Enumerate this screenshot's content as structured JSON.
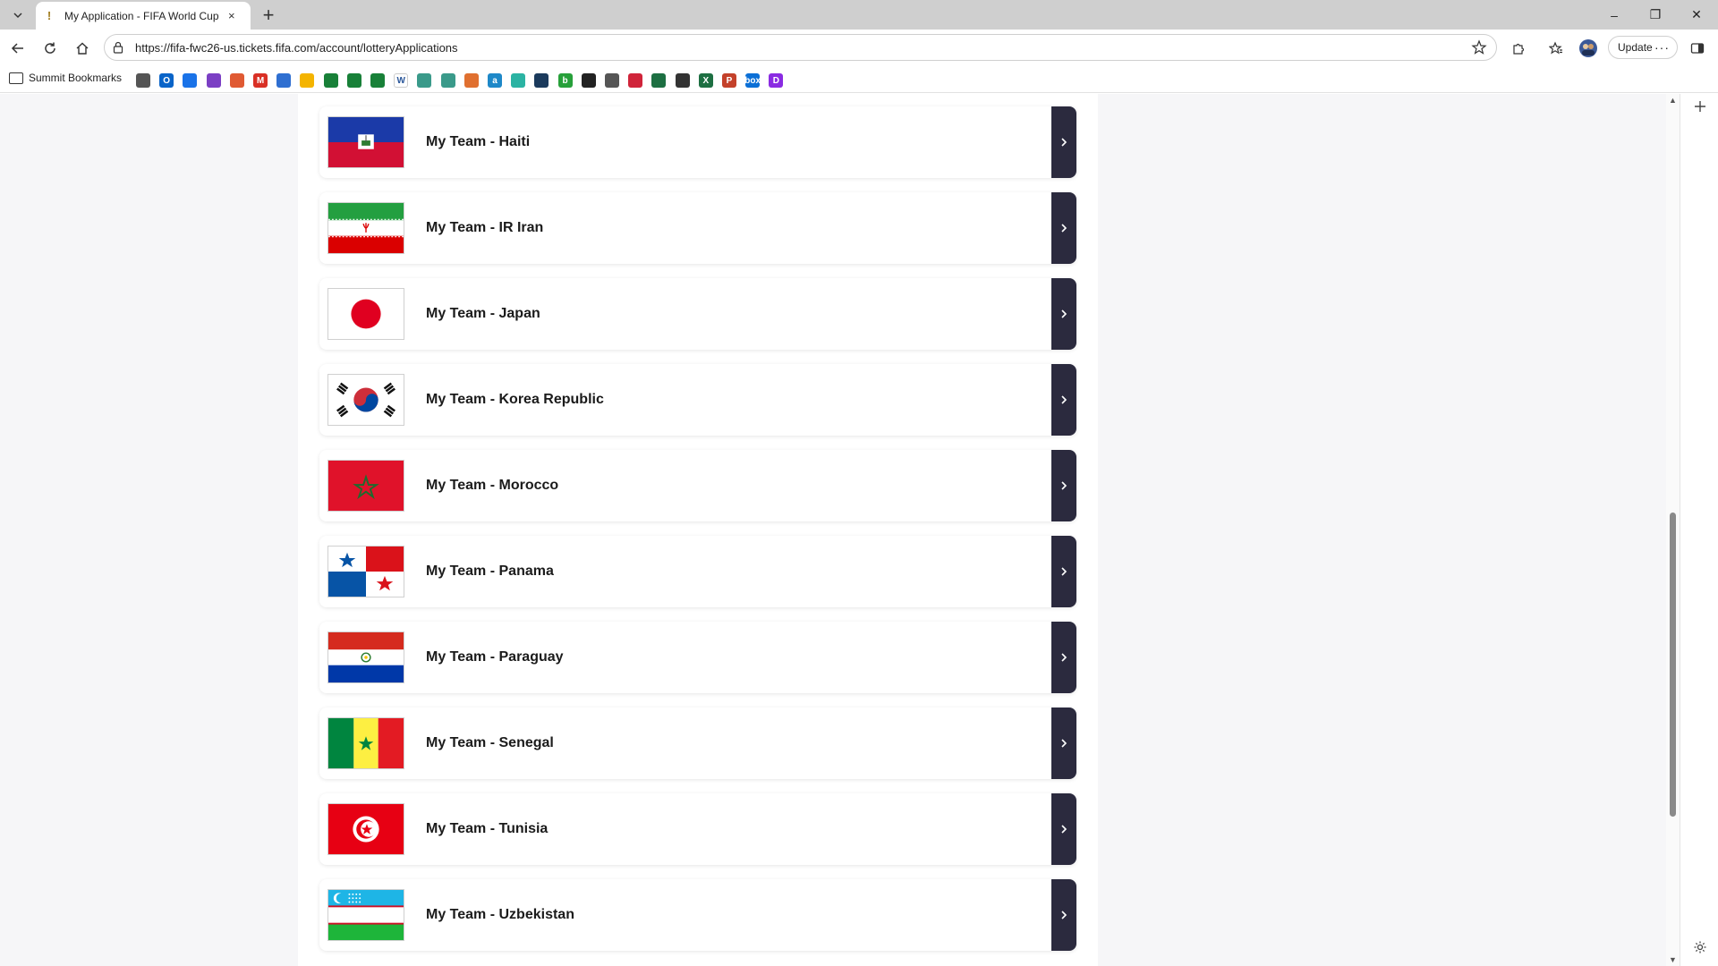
{
  "browser": {
    "tab_title": "My Application - FIFA World Cup",
    "tab_close": "×",
    "new_tab": "+",
    "url": "https://fifa-fwc26-us.tickets.fifa.com/account/lotteryApplications",
    "update_label": "Update",
    "update_more": "···",
    "window_controls": {
      "minimize": "–",
      "restore": "❐",
      "close": "✕"
    },
    "bookmarks_folder": "Summit Bookmarks"
  },
  "bookmarks": [
    {
      "name": "bookmark-cloud",
      "glyph": "",
      "color": "#555555"
    },
    {
      "name": "bookmark-outlook",
      "glyph": "O",
      "color": "#0a64c8"
    },
    {
      "name": "bookmark-calendar",
      "glyph": "",
      "color": "#1a73e8"
    },
    {
      "name": "bookmark-visio",
      "glyph": "",
      "color": "#7b3fc4"
    },
    {
      "name": "bookmark-loop",
      "glyph": "",
      "color": "#e05a33"
    },
    {
      "name": "bookmark-gmail",
      "glyph": "M",
      "color": "#d93025"
    },
    {
      "name": "bookmark-calendar-2",
      "glyph": "",
      "color": "#2f6fd1"
    },
    {
      "name": "bookmark-drive",
      "glyph": "",
      "color": "#f4b400"
    },
    {
      "name": "bookmark-sheets-1",
      "glyph": "",
      "color": "#188038"
    },
    {
      "name": "bookmark-sheets-2",
      "glyph": "",
      "color": "#188038"
    },
    {
      "name": "bookmark-sheets-3",
      "glyph": "",
      "color": "#188038"
    },
    {
      "name": "bookmark-word",
      "glyph": "W",
      "color": "#ffffff"
    },
    {
      "name": "bookmark-app-1",
      "glyph": "",
      "color": "#3a9a8a"
    },
    {
      "name": "bookmark-app-2",
      "glyph": "",
      "color": "#3a9a8a"
    },
    {
      "name": "bookmark-app-3",
      "glyph": "",
      "color": "#e07030"
    },
    {
      "name": "bookmark-amazon",
      "glyph": "a",
      "color": "#1e88c8"
    },
    {
      "name": "bookmark-app-4",
      "glyph": "",
      "color": "#2bb3a3"
    },
    {
      "name": "bookmark-app-5",
      "glyph": "",
      "color": "#1b3a5c"
    },
    {
      "name": "bookmark-app-6",
      "glyph": "b",
      "color": "#27a03a"
    },
    {
      "name": "bookmark-app-7",
      "glyph": "",
      "color": "#222222"
    },
    {
      "name": "bookmark-globe",
      "glyph": "",
      "color": "#555555"
    },
    {
      "name": "bookmark-app-8",
      "glyph": "",
      "color": "#d0243a"
    },
    {
      "name": "bookmark-excel-1",
      "glyph": "",
      "color": "#1d6f42"
    },
    {
      "name": "bookmark-app-9",
      "glyph": "",
      "color": "#333333"
    },
    {
      "name": "bookmark-excel-2",
      "glyph": "X",
      "color": "#1d6f42"
    },
    {
      "name": "bookmark-powerpoint",
      "glyph": "P",
      "color": "#c4412a"
    },
    {
      "name": "bookmark-box",
      "glyph": "box",
      "color": "#0b6fd6"
    },
    {
      "name": "bookmark-app-10",
      "glyph": "D",
      "color": "#8a2be2"
    }
  ],
  "teams": [
    {
      "label": "My Team - Haiti",
      "flag": "haiti"
    },
    {
      "label": "My Team - IR Iran",
      "flag": "iran"
    },
    {
      "label": "My Team - Japan",
      "flag": "japan"
    },
    {
      "label": "My Team - Korea Republic",
      "flag": "korea"
    },
    {
      "label": "My Team - Morocco",
      "flag": "morocco"
    },
    {
      "label": "My Team - Panama",
      "flag": "panama"
    },
    {
      "label": "My Team - Paraguay",
      "flag": "paraguay"
    },
    {
      "label": "My Team - Senegal",
      "flag": "senegal"
    },
    {
      "label": "My Team - Tunisia",
      "flag": "tunisia"
    },
    {
      "label": "My Team - Uzbekistan",
      "flag": "uzbekistan"
    }
  ],
  "colors": {
    "arrow_button": "#2b2a3e",
    "page_background": "#f6f6f8"
  },
  "scroll_position": 0.62
}
